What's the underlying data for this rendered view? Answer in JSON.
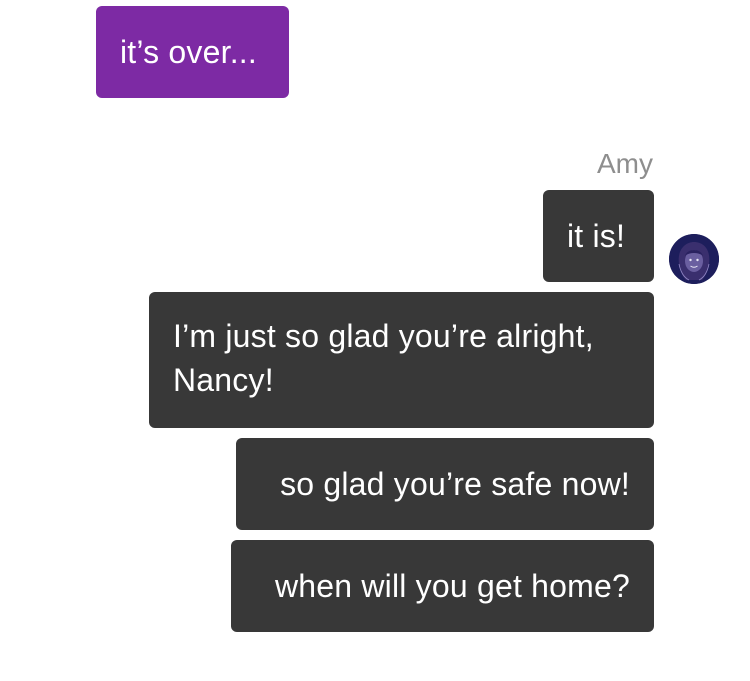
{
  "conversation": {
    "outgoing": [
      {
        "text": "it’s over..."
      }
    ],
    "incoming_sender": "Amy",
    "incoming": [
      {
        "text": "it is!"
      },
      {
        "text": "I’m just so glad you’re alright, Nancy!"
      },
      {
        "text": "so glad you’re safe now!"
      },
      {
        "text": "when will you get home?"
      }
    ],
    "avatar_icon": "profile-avatar-icon"
  },
  "colors": {
    "outgoing_bubble": "#7d2aa4",
    "incoming_bubble": "#383838",
    "sender_name": "#8e8e8e",
    "bubble_text": "#ffffff",
    "avatar_bg": "#1d1e5c"
  }
}
